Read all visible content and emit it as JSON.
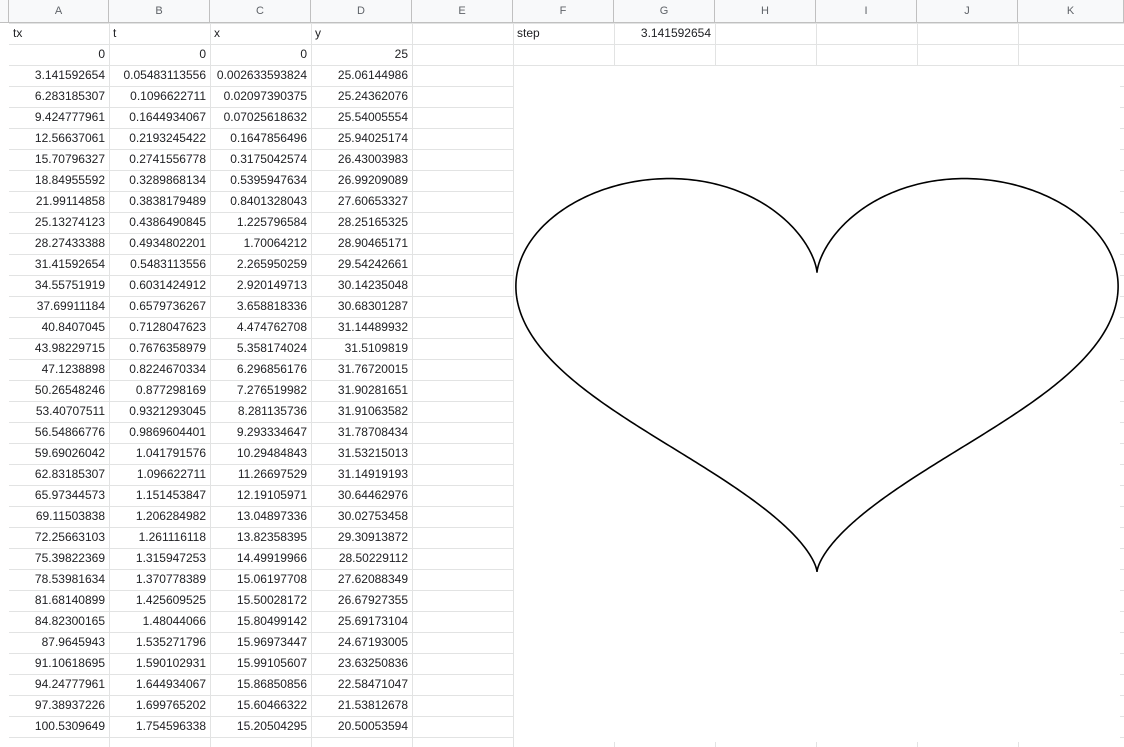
{
  "columns": [
    "A",
    "B",
    "C",
    "D",
    "E",
    "F",
    "G",
    "H",
    "I",
    "J",
    "K"
  ],
  "headers": [
    "tx",
    "t",
    "x",
    "y"
  ],
  "step_label": "step",
  "step_value": "3.141592654",
  "rows": [
    [
      "0",
      "0",
      "0",
      "25"
    ],
    [
      "3.141592654",
      "0.05483113556",
      "0.002633593824",
      "25.06144986"
    ],
    [
      "6.283185307",
      "0.1096622711",
      "0.02097390375",
      "25.24362076"
    ],
    [
      "9.424777961",
      "0.1644934067",
      "0.07025618632",
      "25.54005554"
    ],
    [
      "12.56637061",
      "0.2193245422",
      "0.1647856496",
      "25.94025174"
    ],
    [
      "15.70796327",
      "0.2741556778",
      "0.3175042574",
      "26.43003983"
    ],
    [
      "18.84955592",
      "0.3289868134",
      "0.5395947634",
      "26.99209089"
    ],
    [
      "21.99114858",
      "0.3838179489",
      "0.8401328043",
      "27.60653327"
    ],
    [
      "25.13274123",
      "0.4386490845",
      "1.225796584",
      "28.25165325"
    ],
    [
      "28.27433388",
      "0.4934802201",
      "1.70064212",
      "28.90465171"
    ],
    [
      "31.41592654",
      "0.5483113556",
      "2.265950259",
      "29.54242661"
    ],
    [
      "34.55751919",
      "0.6031424912",
      "2.920149713",
      "30.14235048"
    ],
    [
      "37.69911184",
      "0.6579736267",
      "3.658818336",
      "30.68301287"
    ],
    [
      "40.8407045",
      "0.7128047623",
      "4.474762708",
      "31.14489932"
    ],
    [
      "43.98229715",
      "0.7676358979",
      "5.358174024",
      "31.5109819"
    ],
    [
      "47.1238898",
      "0.8224670334",
      "6.296856176",
      "31.76720015"
    ],
    [
      "50.26548246",
      "0.877298169",
      "7.276519982",
      "31.90281651"
    ],
    [
      "53.40707511",
      "0.9321293045",
      "8.281135736",
      "31.91063582"
    ],
    [
      "56.54866776",
      "0.9869604401",
      "9.293334647",
      "31.78708434"
    ],
    [
      "59.69026042",
      "1.041791576",
      "10.29484843",
      "31.53215013"
    ],
    [
      "62.83185307",
      "1.096622711",
      "11.26697529",
      "31.14919193"
    ],
    [
      "65.97344573",
      "1.151453847",
      "12.19105971",
      "30.64462976"
    ],
    [
      "69.11503838",
      "1.206284982",
      "13.04897336",
      "30.02753458"
    ],
    [
      "72.25663103",
      "1.261116118",
      "13.82358395",
      "29.30913872"
    ],
    [
      "75.39822369",
      "1.315947253",
      "14.49919966",
      "28.50229112"
    ],
    [
      "78.53981634",
      "1.370778389",
      "15.06197708",
      "27.62088349"
    ],
    [
      "81.68140899",
      "1.425609525",
      "15.50028172",
      "26.67927355"
    ],
    [
      "84.82300165",
      "1.48044066",
      "15.80499142",
      "25.69173104"
    ],
    [
      "87.9645943",
      "1.535271796",
      "15.96973447",
      "24.67193005"
    ],
    [
      "91.10618695",
      "1.590102931",
      "15.99105607",
      "23.63250836"
    ],
    [
      "94.24777961",
      "1.644934067",
      "15.86850856",
      "22.58471047"
    ],
    [
      "97.38937226",
      "1.699765202",
      "15.60466322",
      "21.53812678"
    ],
    [
      "100.5309649",
      "1.754596338",
      "15.20504295",
      "20.50053594"
    ]
  ],
  "chart_data": {
    "type": "scatter",
    "title": "",
    "xlabel": "",
    "ylabel": "",
    "xlim": [
      -16.1,
      16.1
    ],
    "ylim": [
      -17.5,
      32.2
    ],
    "grid": false,
    "legend": "none",
    "line_color": "#000000",
    "series": [
      {
        "x": [
          0,
          0.002633593824,
          0.02097390375,
          0.07025618632,
          0.1647856496,
          0.3175042574,
          0.5395947634,
          0.8401328043,
          1.225796584,
          1.70064212,
          2.265950259,
          2.920149713,
          3.658818336,
          4.474762708,
          5.358174024,
          6.296856176,
          7.276519982,
          8.281135736,
          9.293334647,
          10.29484843,
          11.26697529,
          12.19105971,
          13.04897336,
          13.82358395,
          14.49919966,
          15.06197708,
          15.50028172,
          15.80499142,
          15.96973447,
          15.99105607,
          15.86850856,
          15.60466322,
          15.20504295
        ],
        "y": [
          25,
          25.06144986,
          25.24362076,
          25.54005554,
          25.94025174,
          26.43003983,
          26.99209089,
          27.60653327,
          28.25165325,
          28.90465171,
          29.54242661,
          30.14235048,
          30.68301287,
          31.14489932,
          31.5109819,
          31.76720015,
          31.90281651,
          31.91063582,
          31.78708434,
          31.53215013,
          31.14919193,
          30.64462976,
          30.02753458,
          29.30913872,
          28.50229112,
          27.62088349,
          26.67927355,
          25.69173104,
          24.67193005,
          23.63250836,
          22.58471047,
          21.53812678,
          20.50053594
        ]
      }
    ]
  }
}
